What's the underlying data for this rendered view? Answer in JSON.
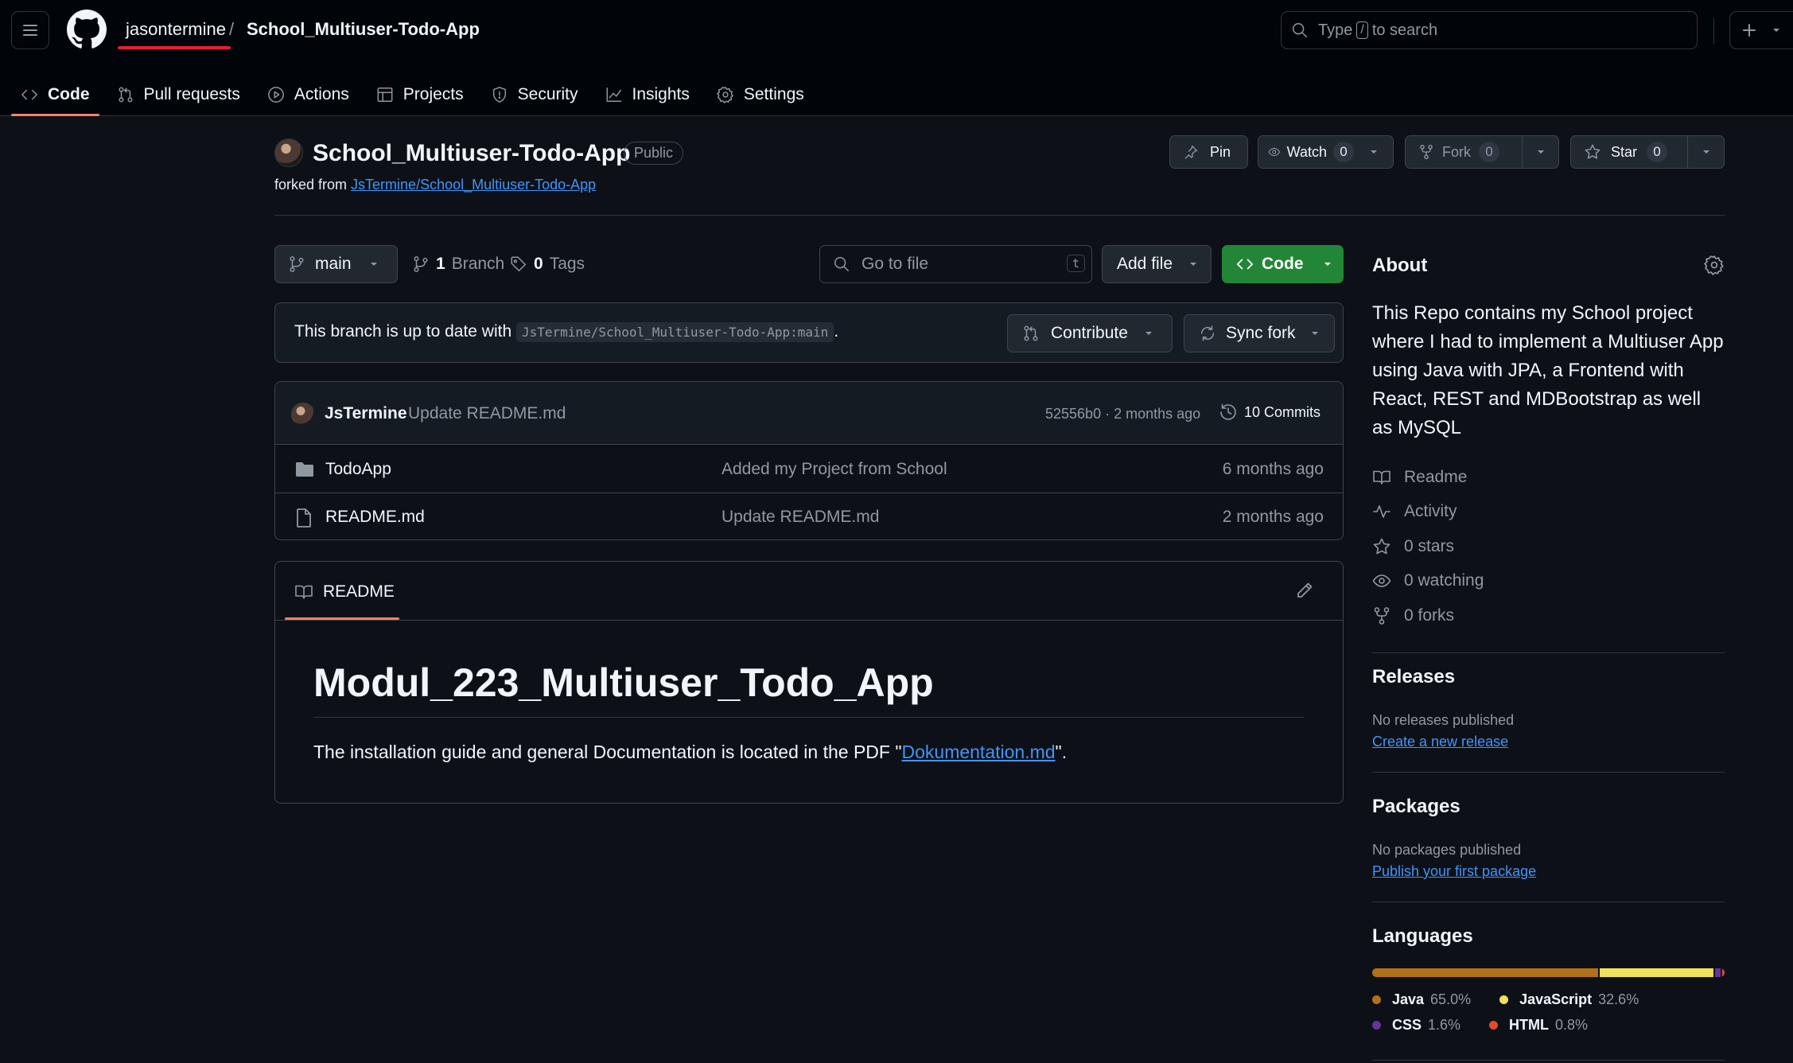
{
  "header": {
    "owner": "jasontermine",
    "separator": "/",
    "repo": "School_Multiuser-Todo-App",
    "search_prefix": "Type",
    "search_key": "/",
    "search_suffix": "to search"
  },
  "tabs": [
    {
      "label": "Code",
      "icon": "code-icon",
      "active": true
    },
    {
      "label": "Pull requests",
      "icon": "pull-request-icon"
    },
    {
      "label": "Actions",
      "icon": "play-icon"
    },
    {
      "label": "Projects",
      "icon": "table-icon"
    },
    {
      "label": "Security",
      "icon": "shield-icon"
    },
    {
      "label": "Insights",
      "icon": "graph-icon"
    },
    {
      "label": "Settings",
      "icon": "gear-icon"
    }
  ],
  "repo": {
    "title": "School_Multiuser-Todo-App",
    "visibility": "Public",
    "forked_prefix": "forked from",
    "forked_from": "JsTermine/School_Multiuser-Todo-App"
  },
  "actions": {
    "pin": "Pin",
    "watch": "Watch",
    "watch_count": "0",
    "fork": "Fork",
    "fork_count": "0",
    "star": "Star",
    "star_count": "0"
  },
  "filenav": {
    "branch": "main",
    "branch_count": "1",
    "branch_label": "Branch",
    "tag_count": "0",
    "tag_label": "Tags",
    "goto_placeholder": "Go to file",
    "goto_key": "t",
    "add_file": "Add file",
    "code": "Code"
  },
  "sync": {
    "text": "This branch is up to date with",
    "ref": "JsTermine/School_Multiuser-Todo-App:main",
    "period": ".",
    "contribute": "Contribute",
    "sync_fork": "Sync fork"
  },
  "commit": {
    "author": "JsTermine",
    "message": "Update README.md",
    "meta": "52556b0 · 2 months ago",
    "count": "10 Commits"
  },
  "files": [
    {
      "type": "folder",
      "name": "TodoApp",
      "message": "Added my Project from School",
      "date": "6 months ago"
    },
    {
      "type": "file",
      "name": "README.md",
      "message": "Update README.md",
      "date": "2 months ago"
    }
  ],
  "readme": {
    "tab": "README",
    "heading": "Modul_223_Multiuser_Todo_App",
    "text_before": "The installation guide and general Documentation is located in the PDF \"",
    "link": "Dokumentation.md",
    "text_after": "\"."
  },
  "about": {
    "title": "About",
    "description": "This Repo contains my School project where I had to implement a Multiuser App using Java with JPA, a Frontend with React, REST and MDBootstrap as well as MySQL",
    "items": [
      {
        "icon": "book-icon",
        "label": "Readme"
      },
      {
        "icon": "pulse-icon",
        "label": "Activity"
      },
      {
        "icon": "star-icon",
        "label": "0 stars"
      },
      {
        "icon": "eye-icon",
        "label": "0 watching"
      },
      {
        "icon": "fork-icon",
        "label": "0 forks"
      }
    ]
  },
  "releases": {
    "title": "Releases",
    "note": "No releases published",
    "link": "Create a new release"
  },
  "packages": {
    "title": "Packages",
    "note": "No packages published",
    "link": "Publish your first package"
  },
  "languages": {
    "title": "Languages",
    "items": [
      {
        "name": "Java",
        "percent": "65.0%",
        "value": 65.0,
        "color": "#b07219"
      },
      {
        "name": "JavaScript",
        "percent": "32.6%",
        "value": 32.6,
        "color": "#f1e05a"
      },
      {
        "name": "CSS",
        "percent": "1.6%",
        "value": 1.6,
        "color": "#663399"
      },
      {
        "name": "HTML",
        "percent": "0.8%",
        "value": 0.8,
        "color": "#e34c26"
      }
    ]
  }
}
